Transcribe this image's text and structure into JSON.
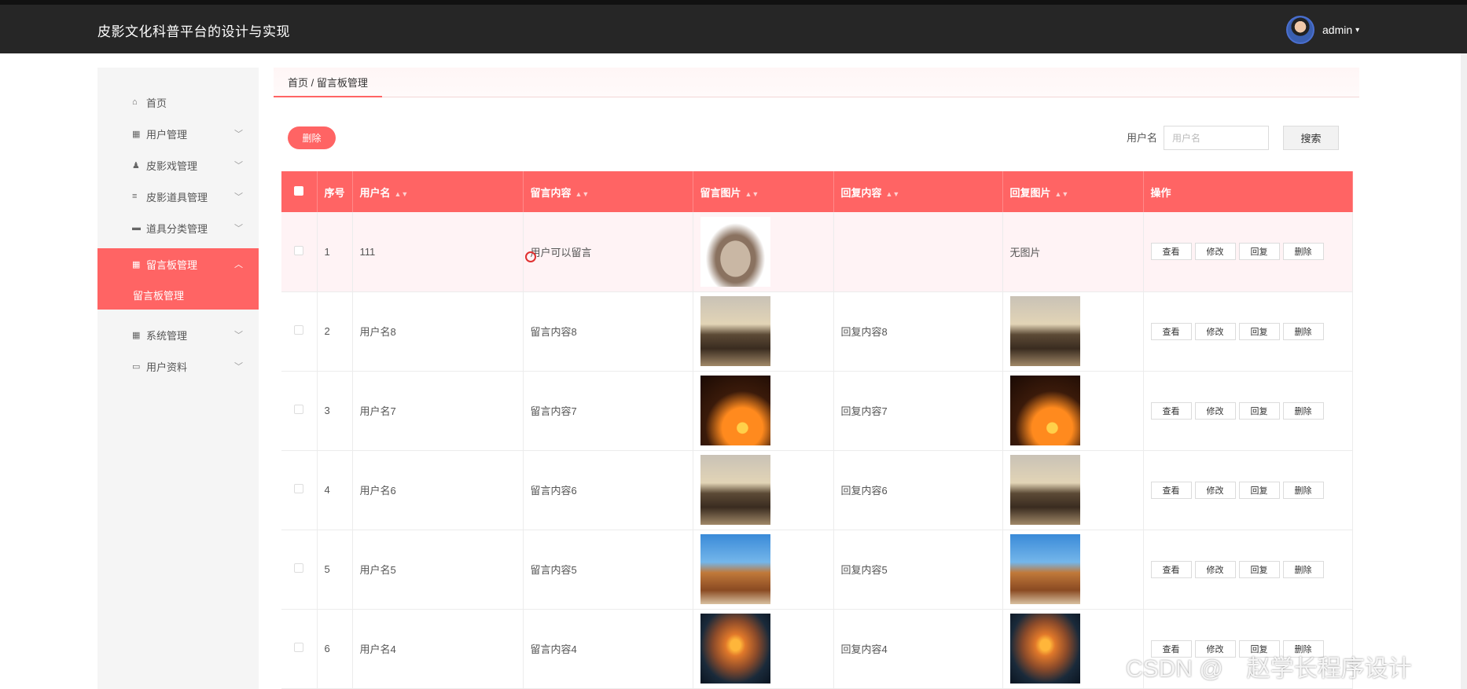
{
  "app": {
    "title": "皮影文化科普平台的设计与实现",
    "user": "admin"
  },
  "sidebar": {
    "items": [
      {
        "label": "首页",
        "icon": "home-icon",
        "glyph": "⌂"
      },
      {
        "label": "用户管理",
        "icon": "grid-icon",
        "glyph": "▦"
      },
      {
        "label": "皮影戏管理",
        "icon": "person-icon",
        "glyph": "♟"
      },
      {
        "label": "皮影道具管理",
        "icon": "list-icon",
        "glyph": "≡"
      },
      {
        "label": "道具分类管理",
        "icon": "chat-icon",
        "glyph": "▬"
      },
      {
        "label": "留言板管理",
        "icon": "grid-icon",
        "glyph": "▦"
      },
      {
        "label": "系统管理",
        "icon": "grid-icon",
        "glyph": "▦"
      },
      {
        "label": "用户资料",
        "icon": "card-icon",
        "glyph": "▭"
      }
    ],
    "submenu_label": "留言板管理"
  },
  "breadcrumb": "首页 / 留言板管理",
  "toolbar": {
    "delete_label": "删除",
    "search_label": "用户名",
    "search_placeholder": "用户名",
    "search_button": "搜索"
  },
  "table": {
    "headers": [
      "序号",
      "用户名",
      "留言内容",
      "留言图片",
      "回复内容",
      "回复图片",
      "操作"
    ],
    "actions": [
      "查看",
      "修改",
      "回复",
      "删除"
    ],
    "rows": [
      {
        "no": "1",
        "username": "111",
        "content": "用户可以留言",
        "image": "cat",
        "reply": "",
        "reply_image_text": "无图片",
        "reply_image": ""
      },
      {
        "no": "2",
        "username": "用户名8",
        "content": "留言内容8",
        "image": "people",
        "reply": "回复内容8",
        "reply_image_text": "",
        "reply_image": "people"
      },
      {
        "no": "3",
        "username": "用户名7",
        "content": "留言内容7",
        "image": "palm",
        "reply": "回复内容7",
        "reply_image_text": "",
        "reply_image": "palm"
      },
      {
        "no": "4",
        "username": "用户名6",
        "content": "留言内容6",
        "image": "people",
        "reply": "回复内容6",
        "reply_image_text": "",
        "reply_image": "people"
      },
      {
        "no": "5",
        "username": "用户名5",
        "content": "留言内容5",
        "image": "castle",
        "reply": "回复内容5",
        "reply_image_text": "",
        "reply_image": "castle"
      },
      {
        "no": "6",
        "username": "用户名4",
        "content": "留言内容4",
        "image": "sunset",
        "reply": "回复内容4",
        "reply_image_text": "",
        "reply_image": "sunset"
      }
    ]
  },
  "watermark": "CSDN @　赵学长程序设计",
  "colors": {
    "accent": "#ff6464",
    "topbar": "#262626"
  }
}
